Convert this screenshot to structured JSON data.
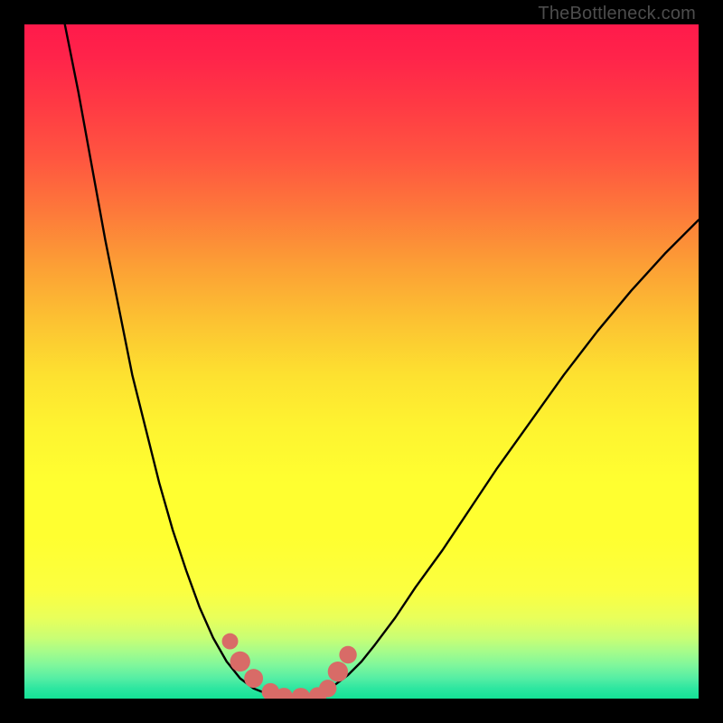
{
  "attribution": "TheBottleneck.com",
  "chart_data": {
    "type": "line",
    "title": "",
    "xlabel": "",
    "ylabel": "",
    "xlim": [
      0,
      100
    ],
    "ylim": [
      0,
      100
    ],
    "grid": false,
    "series": [
      {
        "name": "left-curve",
        "x": [
          6,
          8,
          10,
          12,
          14,
          16,
          18,
          20,
          22,
          24,
          26,
          28,
          30,
          32,
          34,
          36
        ],
        "values": [
          100,
          90,
          79,
          68,
          58,
          48,
          40,
          32,
          25,
          19,
          13.5,
          9,
          5.5,
          3,
          1.5,
          0.7
        ]
      },
      {
        "name": "right-curve",
        "x": [
          44,
          46,
          48,
          50,
          52,
          55,
          58,
          62,
          66,
          70,
          75,
          80,
          85,
          90,
          95,
          100
        ],
        "values": [
          1,
          2,
          3.5,
          5.5,
          8,
          12,
          16.5,
          22,
          28,
          34,
          41,
          48,
          54.5,
          60.5,
          66,
          71
        ]
      }
    ],
    "markers": [
      {
        "x": 30.5,
        "y": 8.5,
        "r": 1.2
      },
      {
        "x": 32.0,
        "y": 5.5,
        "r": 1.5
      },
      {
        "x": 34.0,
        "y": 3.0,
        "r": 1.4
      },
      {
        "x": 36.5,
        "y": 1.0,
        "r": 1.3
      },
      {
        "x": 38.5,
        "y": 0.3,
        "r": 1.3
      },
      {
        "x": 41.0,
        "y": 0.2,
        "r": 1.4
      },
      {
        "x": 43.5,
        "y": 0.4,
        "r": 1.3
      },
      {
        "x": 45.0,
        "y": 1.5,
        "r": 1.3
      },
      {
        "x": 46.5,
        "y": 4.0,
        "r": 1.5
      },
      {
        "x": 48.0,
        "y": 6.5,
        "r": 1.3
      }
    ],
    "background_bands": [
      {
        "y": 100,
        "color": "#ff1a4b"
      },
      {
        "y": 95,
        "color": "#ff244a"
      },
      {
        "y": 88,
        "color": "#ff3a44"
      },
      {
        "y": 80,
        "color": "#ff5640"
      },
      {
        "y": 72,
        "color": "#fd7a3a"
      },
      {
        "y": 64,
        "color": "#fca035"
      },
      {
        "y": 56,
        "color": "#fcc232"
      },
      {
        "y": 48,
        "color": "#fde130"
      },
      {
        "y": 40,
        "color": "#fef430"
      },
      {
        "y": 32,
        "color": "#ffff30"
      },
      {
        "y": 24,
        "color": "#ffff30"
      },
      {
        "y": 16,
        "color": "#fbff40"
      },
      {
        "y": 12,
        "color": "#e9ff5a"
      },
      {
        "y": 9,
        "color": "#c9fe74"
      },
      {
        "y": 7,
        "color": "#a6fc8a"
      },
      {
        "y": 5,
        "color": "#80f79b"
      },
      {
        "y": 3,
        "color": "#55eea4"
      },
      {
        "y": 1.5,
        "color": "#2de6a0"
      },
      {
        "y": 0,
        "color": "#14e196"
      }
    ],
    "marker_color": "#d86b67",
    "curve_color": "#000000"
  }
}
